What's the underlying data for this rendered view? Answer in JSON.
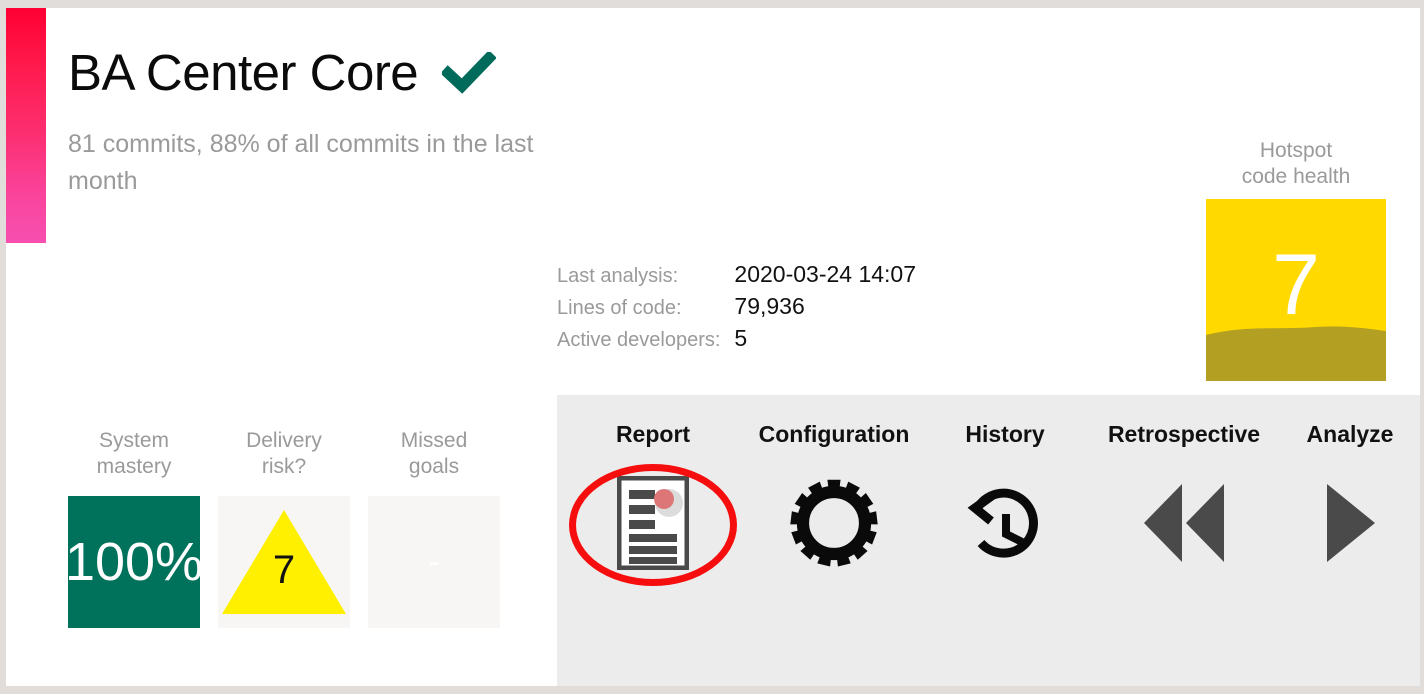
{
  "header": {
    "title": "BA Center Core",
    "verified_icon": "check-icon",
    "verified_color": "#006b5a",
    "subtitle": "81 commits, 88% of all commits in the last month"
  },
  "stats": [
    {
      "label": "Last analysis:",
      "value": "2020-03-24 14:07"
    },
    {
      "label": "Lines of code:",
      "value": "79,936"
    },
    {
      "label": "Active developers:",
      "value": "5"
    }
  ],
  "hotspot": {
    "caption_line1": "Hotspot",
    "caption_line2": "code health",
    "score": "7",
    "box_color": "#ffd900",
    "wave_color": "#b3a022",
    "score_color": "#ffffff"
  },
  "metrics": [
    {
      "label_line1": "System",
      "label_line2": "mastery",
      "value": "100%",
      "style": "teal",
      "box_color": "#00715b",
      "value_color": "#ffffff"
    },
    {
      "label_line1": "Delivery",
      "label_line2": "risk?",
      "value": "7",
      "style": "triangle",
      "box_color": "#f7f6f4",
      "shape_color": "#fff000",
      "value_color": "#111111"
    },
    {
      "label_line1": "Missed",
      "label_line2": "goals",
      "value": "-",
      "style": "dash",
      "box_color": "#f7f6f4",
      "value_color": "#ffffff"
    }
  ],
  "panel": {
    "background": "#ececec",
    "highlight_color": "#f60d0d",
    "items": [
      {
        "label": "Report",
        "icon": "document-report-icon",
        "highlighted": "true"
      },
      {
        "label": "Configuration",
        "icon": "gear-icon",
        "highlighted": "false"
      },
      {
        "label": "History",
        "icon": "clock-rewind-icon",
        "highlighted": "false"
      },
      {
        "label": "Retrospective",
        "icon": "rewind-double-left-icon",
        "highlighted": "false"
      },
      {
        "label": "Analyze",
        "icon": "play-right-icon",
        "highlighted": "false"
      }
    ]
  },
  "accent_bar": {
    "gradient_from": "#ff0033",
    "gradient_to": "#f74fb0"
  }
}
